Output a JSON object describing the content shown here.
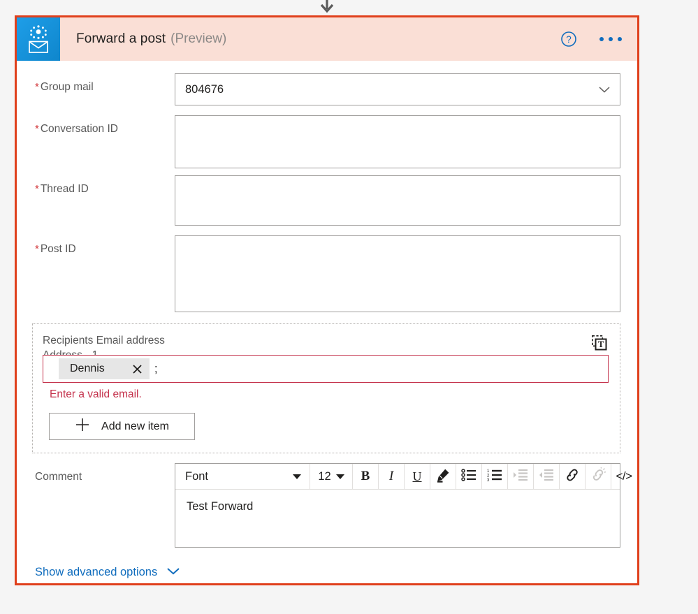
{
  "colors": {
    "card_border": "#e0401c",
    "header_bg": "#fadfd6",
    "icon_tile": "#1b9ae4",
    "accent_link": "#0f6cbd",
    "error": "#c4314b",
    "required_star": "#d13438",
    "page_bg": "#f5f5f5"
  },
  "connector": {
    "arrow_icon": "arrow-down-icon"
  },
  "header": {
    "icon_name": "office365-groups-mail-icon",
    "title": "Forward a post",
    "preview_tag": "(Preview)",
    "help_icon": "help-circle-icon",
    "more_icon": "ellipsis-icon"
  },
  "fields": [
    {
      "label": "Group mail",
      "required": true,
      "type": "combobox",
      "value": "804676",
      "placeholder": "",
      "chevron_icon": "chevron-down-icon",
      "height_class": "combo"
    },
    {
      "label": "Conversation ID",
      "required": true,
      "type": "textbox",
      "value": "",
      "placeholder": "",
      "height_class": "tall-1"
    },
    {
      "label": "Thread ID",
      "required": true,
      "type": "textbox",
      "value": "",
      "placeholder": "",
      "height_class": "tall-2"
    },
    {
      "label": "Post ID",
      "required": true,
      "type": "textbox",
      "value": "",
      "placeholder": "",
      "height_class": "tall-3"
    }
  ],
  "recipients": {
    "title": "Recipients Email address",
    "subtitle": "Address - 1",
    "switch_input_icon": "switch-to-text-input-icon",
    "token": {
      "label": "Dennis",
      "remove_icon": "close-icon"
    },
    "separator": ";",
    "error": "Enter a valid email.",
    "add_button": {
      "label": "Add new item",
      "icon": "plus-icon"
    }
  },
  "comment": {
    "label": "Comment",
    "toolbar": {
      "font_label": "Font",
      "font_caret_icon": "caret-down-icon",
      "size_label": "12",
      "size_caret_icon": "caret-down-icon",
      "buttons": [
        {
          "name": "bold-button",
          "icon": "bold-icon",
          "glyph": "B",
          "disabled": false
        },
        {
          "name": "italic-button",
          "icon": "italic-icon",
          "glyph": "I",
          "disabled": false
        },
        {
          "name": "underline-button",
          "icon": "underline-icon",
          "glyph": "U",
          "disabled": false
        },
        {
          "name": "text-highlight-button",
          "icon": "pen-highlight-icon",
          "glyph": "",
          "disabled": false
        },
        {
          "name": "bulleted-list-button",
          "icon": "bulleted-list-icon",
          "glyph": "",
          "disabled": false
        },
        {
          "name": "numbered-list-button",
          "icon": "numbered-list-icon",
          "glyph": "",
          "disabled": false
        },
        {
          "name": "increase-indent-button",
          "icon": "increase-indent-icon",
          "glyph": "",
          "disabled": true
        },
        {
          "name": "decrease-indent-button",
          "icon": "decrease-indent-icon",
          "glyph": "",
          "disabled": true
        },
        {
          "name": "insert-link-button",
          "icon": "link-icon",
          "glyph": "",
          "disabled": false
        },
        {
          "name": "remove-link-button",
          "icon": "unlink-icon",
          "glyph": "",
          "disabled": true
        },
        {
          "name": "code-view-button",
          "icon": "code-icon",
          "glyph": "</>",
          "disabled": false
        }
      ]
    },
    "value": "Test Forward",
    "placeholder": ""
  },
  "advanced": {
    "label": "Show advanced options",
    "chevron_icon": "chevron-down-icon"
  }
}
